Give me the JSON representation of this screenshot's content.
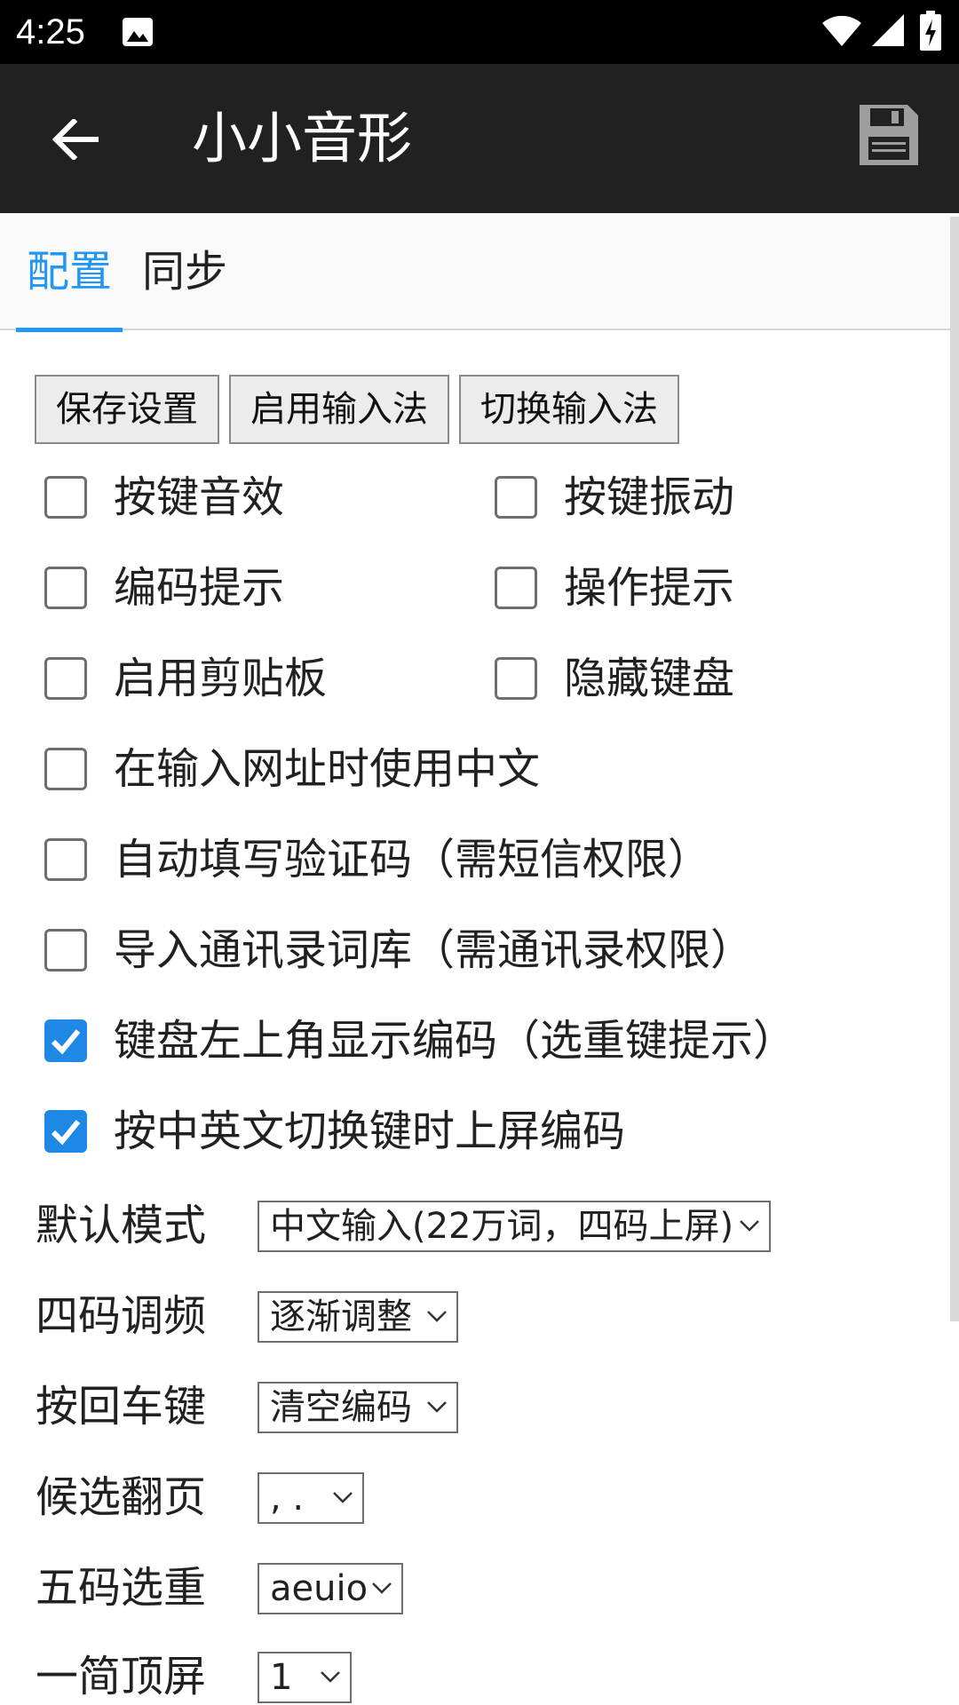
{
  "status_bar": {
    "time": "4:25"
  },
  "app_bar": {
    "title": "小小音形"
  },
  "tabs": [
    {
      "label": "配置",
      "active": true
    },
    {
      "label": "同步",
      "active": false
    }
  ],
  "actions": {
    "save": "保存设置",
    "enable": "启用输入法",
    "switch": "切换输入法"
  },
  "checkboxes": [
    {
      "label": "按键音效",
      "checked": false
    },
    {
      "label": "按键振动",
      "checked": false
    },
    {
      "label": "编码提示",
      "checked": false
    },
    {
      "label": "操作提示",
      "checked": false
    },
    {
      "label": "启用剪贴板",
      "checked": false
    },
    {
      "label": "隐藏键盘",
      "checked": false
    },
    {
      "label": "在输入网址时使用中文",
      "checked": false
    },
    {
      "label": "自动填写验证码（需短信权限）",
      "checked": false
    },
    {
      "label": "导入通讯录词库（需通讯录权限）",
      "checked": false
    },
    {
      "label": "键盘左上角显示编码（选重键提示）",
      "checked": true
    },
    {
      "label": "按中英文切换键时上屏编码",
      "checked": true
    }
  ],
  "settings": [
    {
      "label": "默认模式",
      "value": "中文输入(22万词，四码上屏)"
    },
    {
      "label": "四码调频",
      "value": "逐渐调整"
    },
    {
      "label": "按回车键",
      "value": "清空编码"
    },
    {
      "label": "候选翻页",
      "value": ", ."
    },
    {
      "label": "五码选重",
      "value": "aeuio"
    },
    {
      "label": "一简顶屏",
      "value": "1"
    }
  ],
  "colors": {
    "accent": "#2196f3",
    "checkbox_checked": "#1e88e5",
    "app_bar": "#212121",
    "status_bar": "#000000"
  }
}
